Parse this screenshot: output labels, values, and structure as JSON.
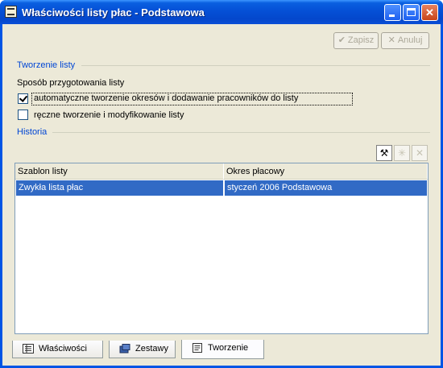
{
  "window": {
    "title": "Właściwości listy płac - Podstawowa",
    "controls": {
      "minimize": "minimize",
      "maximize": "maximize",
      "close": "✕"
    }
  },
  "toolbar": {
    "save_label": "Zapisz",
    "save_icon": "✔",
    "cancel_label": "Anuluj",
    "cancel_icon": "✕"
  },
  "tworzenie": {
    "group_label": "Tworzenie listy",
    "method_label": "Sposób przygotowania listy",
    "options": [
      {
        "label": "automatyczne tworzenie okresów i dodawanie pracowników do listy",
        "checked": true
      },
      {
        "label": "ręczne tworzenie i modyfikowanie listy",
        "checked": false
      }
    ]
  },
  "historia": {
    "group_label": "Historia",
    "tools": [
      {
        "icon": "tools-icon",
        "glyph": "⚒",
        "enabled": true
      },
      {
        "icon": "star-icon",
        "glyph": "✳",
        "enabled": false
      },
      {
        "icon": "delete-icon",
        "glyph": "✕",
        "enabled": false
      }
    ],
    "columns": [
      "Szablon listy",
      "Okres płacowy"
    ],
    "rows": [
      [
        "Zwykła lista płac",
        "styczeń 2006 Podstawowa"
      ]
    ]
  },
  "tabs": [
    {
      "label": "Właściwości",
      "icon": "properties-icon",
      "active": false
    },
    {
      "label": "Zestawy",
      "icon": "sets-icon",
      "active": false
    },
    {
      "label": "Tworzenie",
      "icon": "document-icon",
      "active": true
    }
  ],
  "colors": {
    "title_bar": "#0550d6",
    "selection": "#316ac5",
    "group_label": "#0046d5"
  }
}
